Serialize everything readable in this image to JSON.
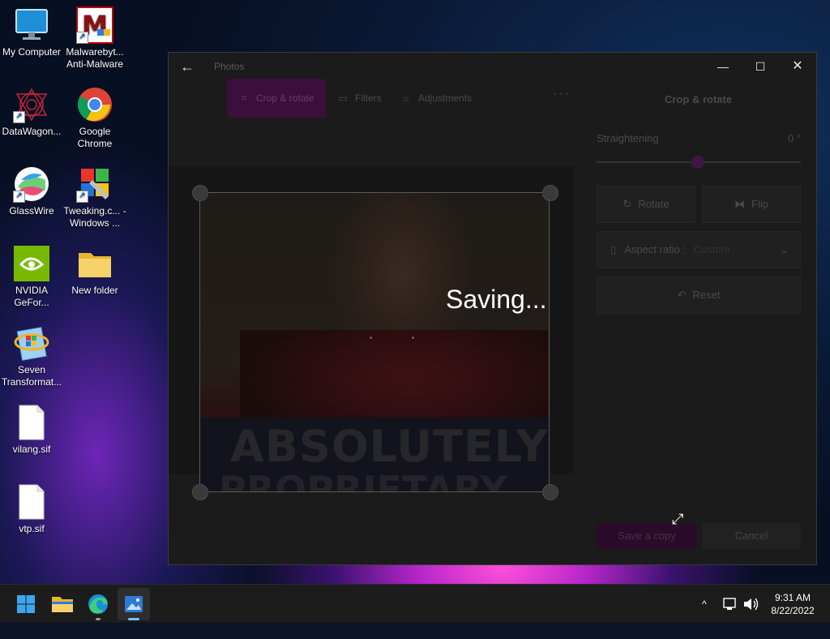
{
  "desktop": {
    "icons": [
      {
        "label": "My Computer"
      },
      {
        "label": "Malwarebyt... Anti-Malware"
      },
      {
        "label": "DataWagon..."
      },
      {
        "label": "Google Chrome"
      },
      {
        "label": "GlassWire"
      },
      {
        "label": "Tweaking.c... - Windows ..."
      },
      {
        "label": "NVIDIA GeFor..."
      },
      {
        "label": "New folder"
      },
      {
        "label": "Seven Transformat..."
      },
      {
        "label": "vilang.sif"
      },
      {
        "label": "vtp.sif"
      }
    ],
    "shortcut_arrow": "↗"
  },
  "window": {
    "title": "Photos",
    "back_glyph": "←",
    "minimize_glyph": "—",
    "maximize_glyph": "☐",
    "close_glyph": "✕",
    "toolbar": {
      "crop": "Crop & rotate",
      "filters": "Filters",
      "adjustments": "Adjustments",
      "more": "···"
    },
    "saving_text": "Saving...",
    "photo_banner_line1": "ABSOLUTELY",
    "photo_banner_line2": "PROPRIETARY",
    "panel": {
      "title": "Crop & rotate",
      "straightening_label": "Straightening",
      "straightening_value": "0 °",
      "rotate": "Rotate",
      "flip": "Flip",
      "aspect_label": "Aspect ratio :",
      "aspect_value": "Custom",
      "reset": "Reset",
      "save_copy": "Save a copy",
      "cancel": "Cancel"
    },
    "accent_color": "#3c0e3c"
  },
  "taskbar": {
    "clock_time": "9:31 AM",
    "clock_date": "8/22/2022",
    "tray_chevron": "^"
  }
}
